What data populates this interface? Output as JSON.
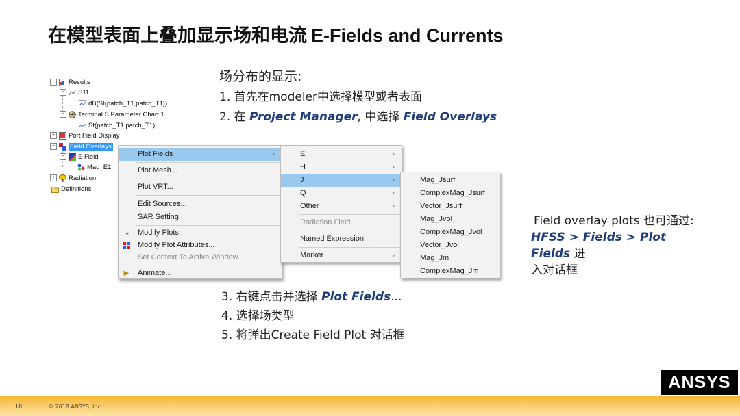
{
  "title": {
    "cn": "在模型表面上叠加显示场和电流",
    "en": "E-Fields and Currents"
  },
  "steps_top": {
    "header": "场分布的显示:",
    "step1": "1. 首先在modeler中选择模型或者表面",
    "step2_prefix": "2. 在 ",
    "step2_em1": "Project Manager",
    "step2_mid": ", 中选择 ",
    "step2_em2": "Field Overlays"
  },
  "tree": {
    "results": "Results",
    "s11": "S11",
    "db": "dB(St(patch_T1,patch_T1))",
    "chart": "Terminal S Parameter Chart 1",
    "st": "St(patch_T1,patch_T1)",
    "port": "Port Field Display",
    "overlays": "Field Overlays",
    "efield": "E Field",
    "mag": "Mag_E1",
    "radiation": "Radiation",
    "definitions": "Definitions"
  },
  "menu1": {
    "plot_fields": "Plot Fields",
    "plot_mesh": "Plot Mesh...",
    "plot_vrt": "Plot VRT...",
    "edit_sources": "Edit Sources...",
    "sar": "SAR Setting...",
    "modify_plots": "Modify Plots...",
    "modify_attr": "Modify Plot Attributes...",
    "set_context": "Set Context To Active Window...",
    "animate": "Animate..."
  },
  "menu2": {
    "e": "E",
    "h": "H",
    "j": "J",
    "q": "Q",
    "other": "Other",
    "radiation_field": "Radiation Field...",
    "named_expr": "Named Expression...",
    "marker": "Marker"
  },
  "menu3": [
    "Mag_Jsurf",
    "ComplexMag_Jsurf",
    "Vector_Jsurf",
    "Mag_Jvol",
    "ComplexMag_Jvol",
    "Vector_Jvol",
    "Mag_Jm",
    "ComplexMag_Jm"
  ],
  "steps_bot": {
    "step3_prefix": "3. 右键点击并选择 ",
    "step3_em": "Plot Fields",
    "step3_suffix": "...",
    "step4": "4. 选择场类型",
    "step5": "5.  将弹出Create Field Plot 对话框"
  },
  "side": {
    "line1": "Field overlay plots 也可通过:",
    "em": "HFSS > Fields >  Plot Fields",
    "line2a": " 进",
    "line2b": "入对话框"
  },
  "logo": "ANSYS",
  "footer": {
    "page": "18",
    "copyright": "© 2018 ANSYS, Inc."
  },
  "colors": {
    "accent": "#1f3d7a",
    "highlight": "#99c9ef",
    "selection": "#3399ff",
    "footer": "#f7b733"
  }
}
